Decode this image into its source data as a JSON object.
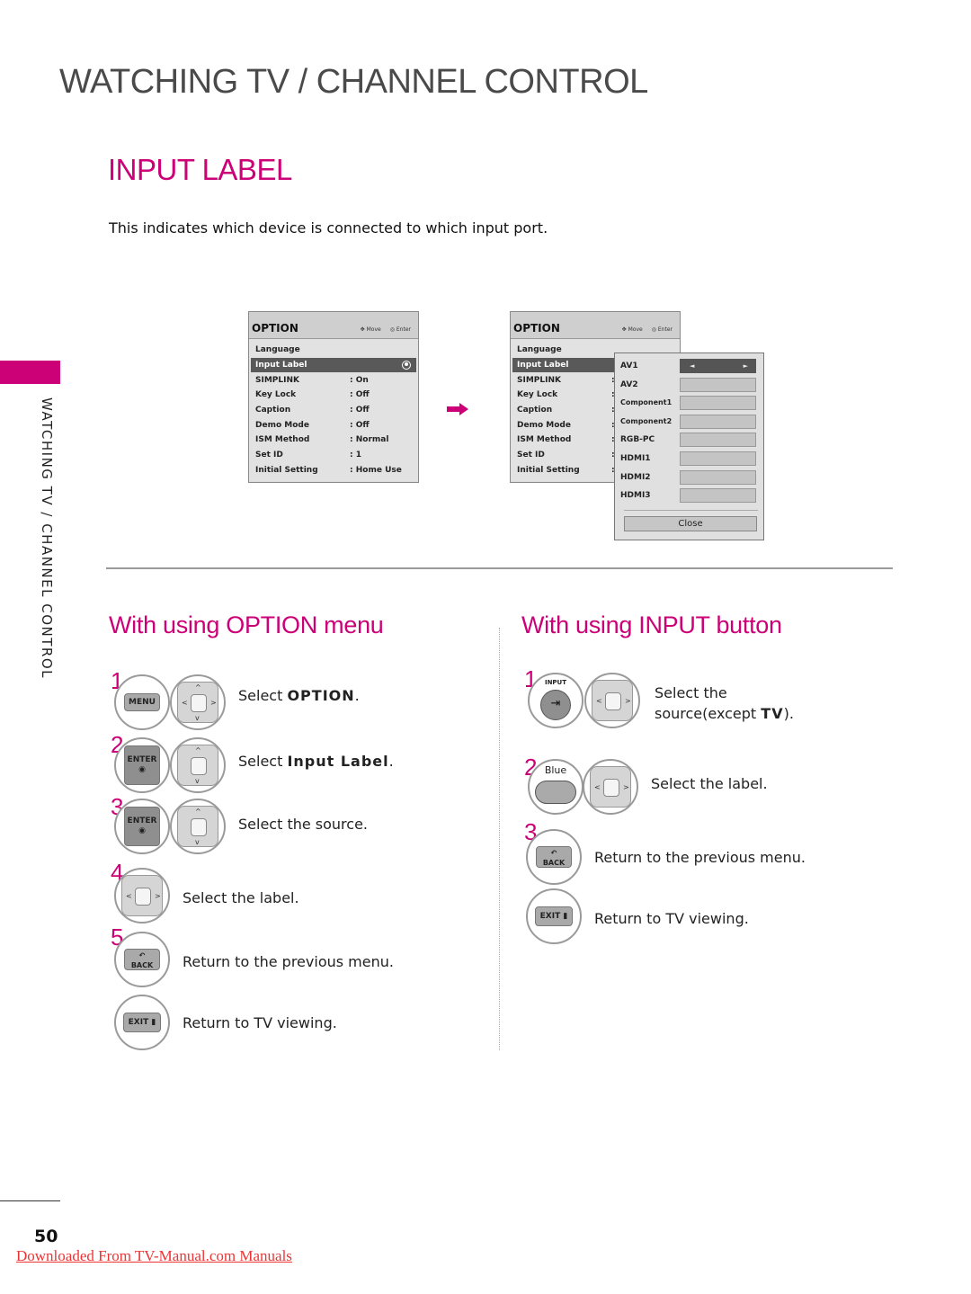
{
  "header": {
    "section_title": "WATCHING TV / CHANNEL CONTROL",
    "page_title": "INPUT LABEL",
    "intro": "This indicates which device is connected to which input port.",
    "side_label": "WATCHING TV / CHANNEL CONTROL"
  },
  "colors": {
    "accent": "#cc0077",
    "link": "#ee3333"
  },
  "osd_menu_1": {
    "title": "OPTION",
    "hint_move": "Move",
    "hint_enter": "Enter",
    "rows": [
      {
        "key": "Language",
        "value": ""
      },
      {
        "key": "Input Label",
        "value": "",
        "selected": true
      },
      {
        "key": "SIMPLINK",
        "value": ": On"
      },
      {
        "key": "Key Lock",
        "value": ": Off"
      },
      {
        "key": "Caption",
        "value": ": Off"
      },
      {
        "key": "Demo Mode",
        "value": ": Off"
      },
      {
        "key": "ISM Method",
        "value": ": Normal"
      },
      {
        "key": "Set ID",
        "value": ": 1"
      },
      {
        "key": "Initial Setting",
        "value": ": Home Use"
      }
    ]
  },
  "osd_menu_2": {
    "title": "OPTION",
    "hint_move": "Move",
    "hint_enter": "Enter",
    "rows": [
      {
        "key": "Language",
        "value": ""
      },
      {
        "key": "Input Label",
        "value": "",
        "selected": true
      },
      {
        "key": "SIMPLINK",
        "value": ":"
      },
      {
        "key": "Key Lock",
        "value": ":"
      },
      {
        "key": "Caption",
        "value": ":"
      },
      {
        "key": "Demo Mode",
        "value": ":"
      },
      {
        "key": "ISM Method",
        "value": ":"
      },
      {
        "key": "Set ID",
        "value": ":"
      },
      {
        "key": "Initial Setting",
        "value": ":"
      }
    ]
  },
  "input_popup": {
    "sources": [
      "AV1",
      "AV2",
      "Component1",
      "Component2",
      "RGB-PC",
      "HDMI1",
      "HDMI2",
      "HDMI3"
    ],
    "selected_index": 0,
    "left_arrow": "◄",
    "right_arrow": "►",
    "close_label": "Close"
  },
  "option_section": {
    "title": "With using OPTION menu",
    "steps": [
      {
        "num": "1",
        "button": "MENU",
        "text_prefix": "Select ",
        "text_bold": "OPTION",
        "text_suffix": "."
      },
      {
        "num": "2",
        "button": "ENTER",
        "text_prefix": "Select ",
        "text_bold": "Input Label",
        "text_suffix": "."
      },
      {
        "num": "3",
        "button": "ENTER",
        "text_prefix": "Select the source.",
        "text_bold": "",
        "text_suffix": ""
      },
      {
        "num": "4",
        "button": "",
        "text_prefix": "Select the label.",
        "text_bold": "",
        "text_suffix": ""
      },
      {
        "num": "5",
        "button": "BACK",
        "text_prefix": "Return to the previous menu.",
        "text_bold": "",
        "text_suffix": ""
      },
      {
        "num": "",
        "button": "EXIT",
        "text_prefix": "Return to TV viewing.",
        "text_bold": "",
        "text_suffix": ""
      }
    ]
  },
  "input_section": {
    "title": "With using INPUT button",
    "steps": [
      {
        "num": "1",
        "button": "INPUT",
        "text_line1": "Select the",
        "text_prefix": "source(except ",
        "text_bold": "TV",
        "text_suffix": ")."
      },
      {
        "num": "2",
        "button": "Blue",
        "text_prefix": "Select the label."
      },
      {
        "num": "3",
        "button": "BACK",
        "text_prefix": "Return to the previous menu."
      },
      {
        "num": "",
        "button": "EXIT",
        "text_prefix": "Return to TV viewing."
      }
    ]
  },
  "buttons": {
    "menu": "MENU",
    "enter": "ENTER",
    "back": "BACK",
    "exit": "EXIT",
    "input": "INPUT",
    "blue": "Blue"
  },
  "nav_glyphs": {
    "up": "^",
    "down": "v",
    "left": "<",
    "right": ">"
  },
  "footer": {
    "page_number": "50",
    "link_text": "Downloaded From TV-Manual.com Manuals"
  }
}
